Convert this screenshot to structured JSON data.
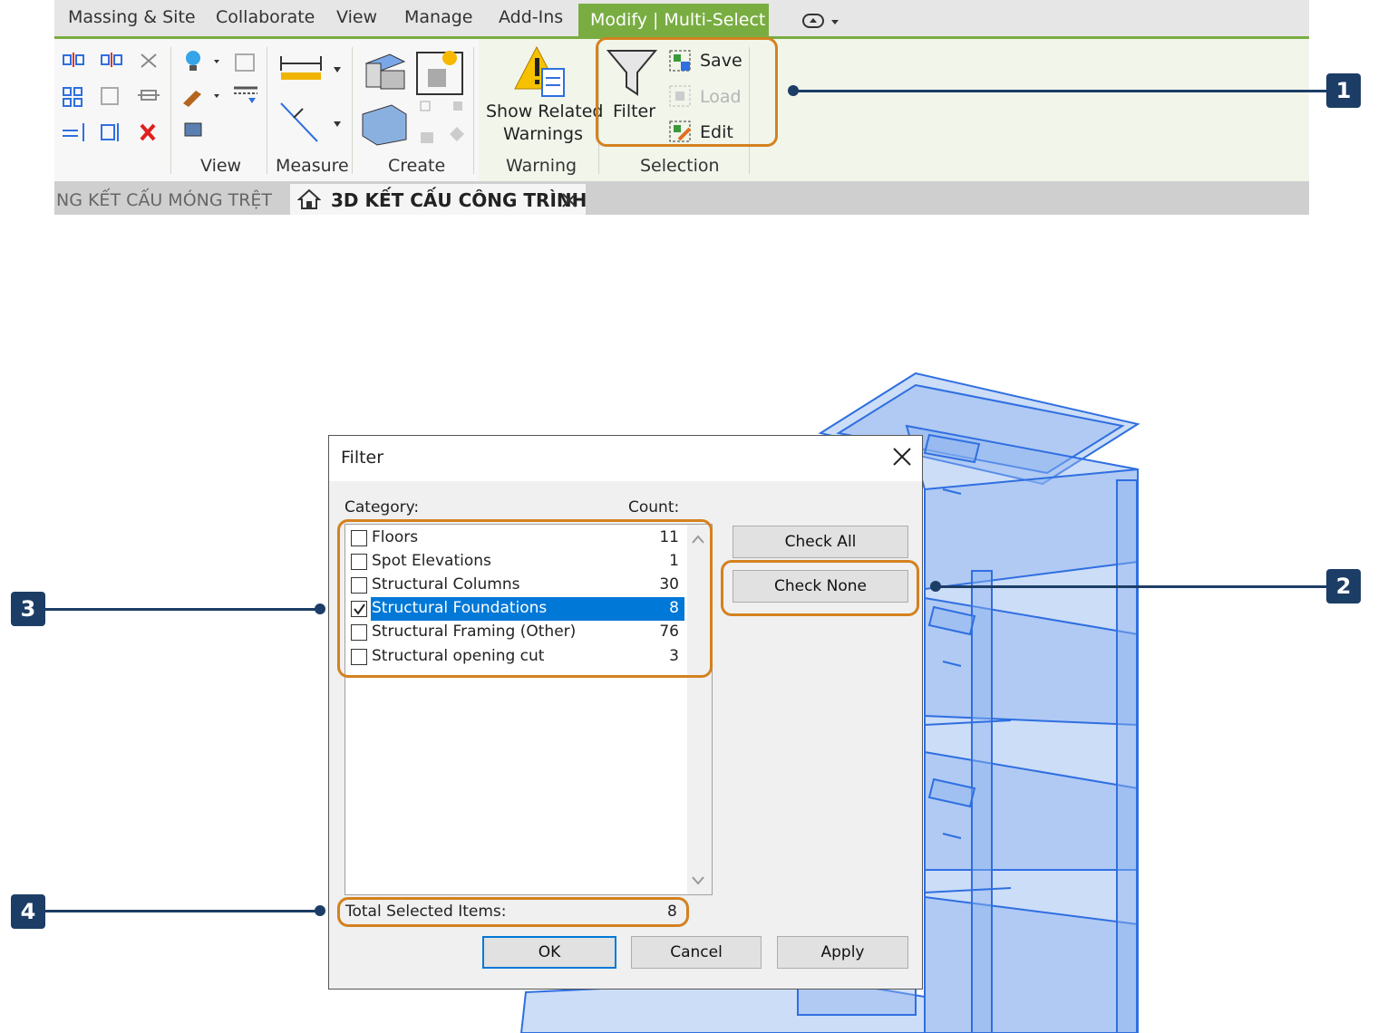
{
  "ribbon": {
    "tabs": [
      "Massing & Site",
      "Collaborate",
      "View",
      "Manage",
      "Add-Ins"
    ],
    "active_tab": "Modify | Multi-Select",
    "panels": {
      "view": "View",
      "measure": "Measure",
      "create": "Create",
      "warning": "Warning",
      "selection": "Selection"
    },
    "show_related_line1": "Show Related",
    "show_related_line2": "Warnings",
    "filter": "Filter",
    "save": "Save",
    "load": "Load",
    "edit": "Edit"
  },
  "view_tabs": {
    "inactive": "NG KẾT CẤU MÓNG TRỆT",
    "active": "3D KẾT CẤU CÔNG TRÌNH"
  },
  "dialog": {
    "title": "Filter",
    "category_header": "Category:",
    "count_header": "Count:",
    "rows": [
      {
        "name": "Floors",
        "count": "11",
        "checked": false
      },
      {
        "name": "Spot Elevations",
        "count": "1",
        "checked": false
      },
      {
        "name": "Structural Columns",
        "count": "30",
        "checked": false
      },
      {
        "name": "Structural Foundations",
        "count": "8",
        "checked": true
      },
      {
        "name": "Structural Framing (Other)",
        "count": "76",
        "checked": false
      },
      {
        "name": "Structural opening cut",
        "count": "3",
        "checked": false
      }
    ],
    "check_all": "Check All",
    "check_none": "Check None",
    "total_label": "Total Selected Items:",
    "total_value": "8",
    "ok": "OK",
    "cancel": "Cancel",
    "apply": "Apply"
  },
  "callouts": [
    "1",
    "2",
    "3",
    "4"
  ],
  "colors": {
    "accent_green": "#79ad42",
    "callout_orange": "#d4811f",
    "callout_navy": "#1c3d66",
    "model_blue": "#2f6fe0",
    "selection_blue": "#0078d7"
  }
}
